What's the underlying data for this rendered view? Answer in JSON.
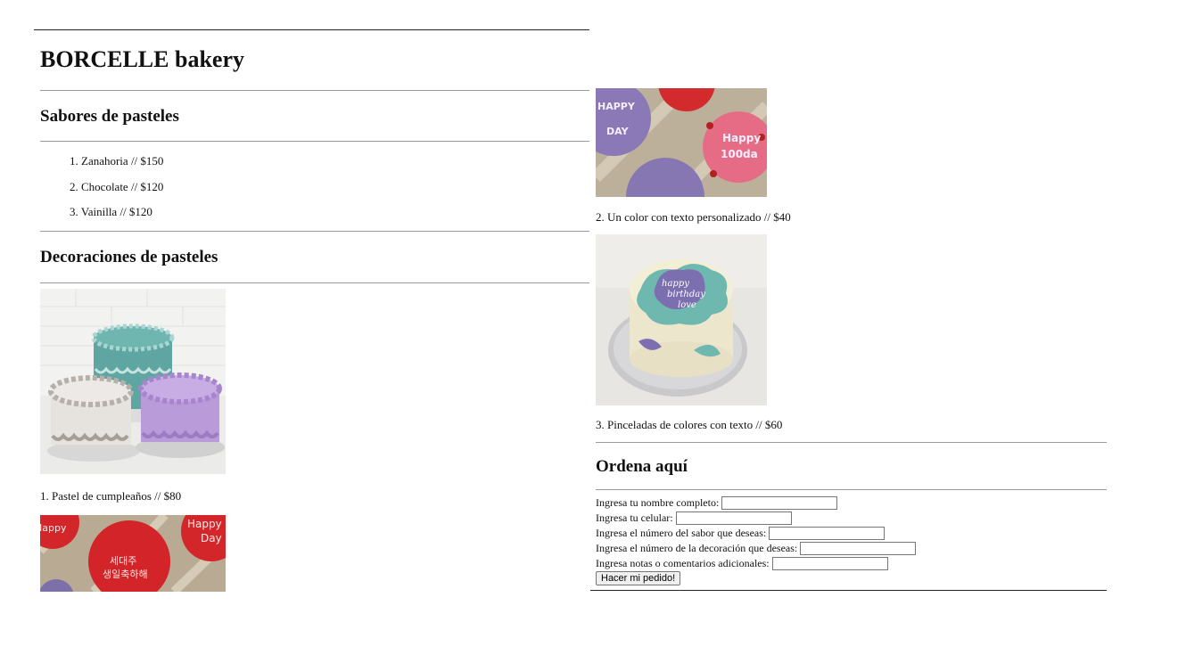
{
  "header": {
    "title": "BORCELLE bakery"
  },
  "flavors": {
    "heading": "Sabores de pasteles",
    "items": [
      {
        "num": "1.",
        "label": "Zanahoria // $150"
      },
      {
        "num": "2.",
        "label": "Chocolate // $120"
      },
      {
        "num": "3.",
        "label": "Vainilla // $120"
      }
    ]
  },
  "decorations": {
    "heading": "Decoraciones de pasteles",
    "items": [
      {
        "caption": "1. Pastel de cumpleaños // $80"
      },
      {
        "caption": "2. Un color con texto personalizado // $40"
      },
      {
        "caption": "3. Pinceladas de colores con texto // $60"
      }
    ]
  },
  "order": {
    "heading": "Ordena aquí",
    "fields": [
      {
        "label": "Ingresa tu nombre completo:",
        "value": ""
      },
      {
        "label": "Ingresa tu celular:",
        "value": ""
      },
      {
        "label": "Ingresa el número del sabor que deseas:",
        "value": ""
      },
      {
        "label": "Ingresa el número de la decoración que deseas:",
        "value": ""
      },
      {
        "label": "Ingresa notas o comentarios adicionales:",
        "value": ""
      }
    ],
    "submit_label": "Hacer mi pedido!"
  },
  "image_text": {
    "img2_left": [
      "Happy",
      "Day"
    ],
    "img2_mid": [
      "세대주",
      "생일축하해"
    ],
    "img2_right": [
      "Happy",
      "Day"
    ],
    "img3_cakes": [
      "HAPPY",
      "DAY",
      "Happy",
      "100da"
    ],
    "img4_cake": [
      "happy",
      "birthday",
      "love"
    ]
  }
}
